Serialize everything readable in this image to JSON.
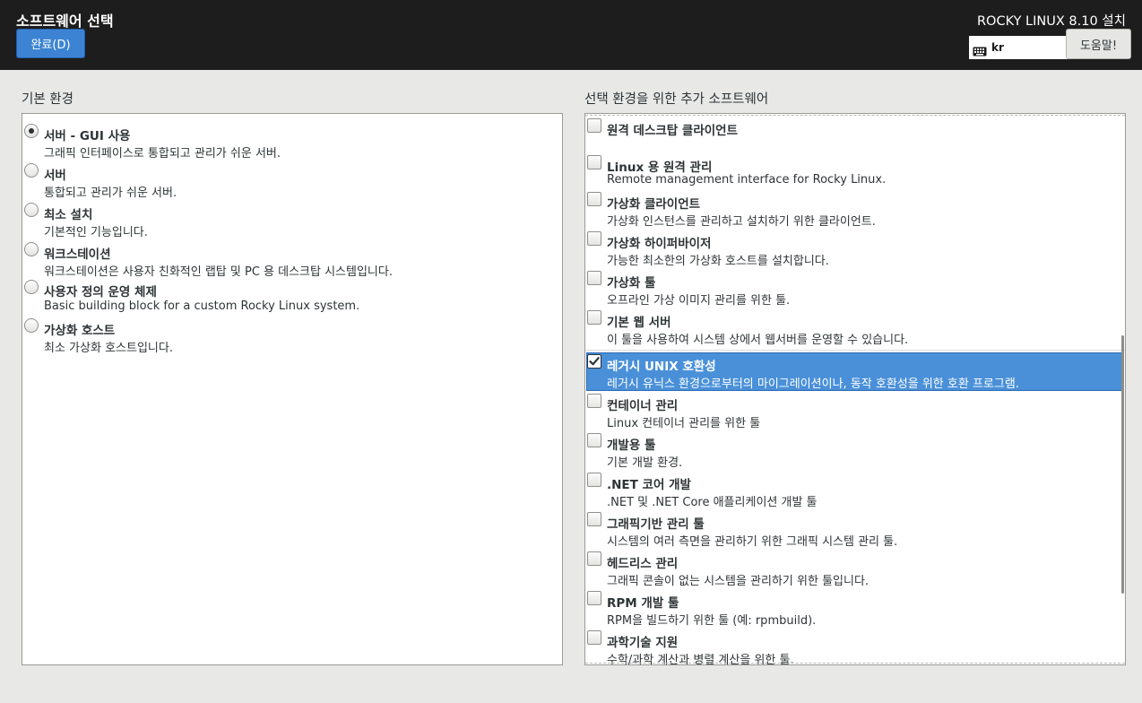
{
  "header": {
    "title": "소프트웨어 선택",
    "done_label": "완료(D)",
    "distro": "ROCKY LINUX 8.10 설치",
    "keyboard_layout": "kr",
    "help_label": "도움말!"
  },
  "base_env": {
    "label": "기본 환경",
    "items": [
      {
        "name": "서버 - GUI 사용",
        "desc": "그래픽 인터페이스로 통합되고 관리가 쉬운 서버.",
        "selected": true
      },
      {
        "name": "서버",
        "desc": "통합되고 관리가 쉬운 서버.",
        "selected": false
      },
      {
        "name": "최소 설치",
        "desc": "기본적인 기능입니다.",
        "selected": false
      },
      {
        "name": "워크스테이션",
        "desc": "워크스테이션은 사용자 친화적인 랩탑 및 PC 용 데스크탑 시스템입니다.",
        "selected": false
      },
      {
        "name": "사용자 정의 운영 체제",
        "desc": "Basic building block for a custom Rocky Linux system.",
        "selected": false
      },
      {
        "name": "가상화 호스트",
        "desc": "최소 가상화 호스트입니다.",
        "selected": false
      }
    ]
  },
  "addons": {
    "label": "선택 환경을 위한 추가 소프트웨어",
    "items": [
      {
        "name": "원격 데스크탑 클라이언트",
        "desc": "",
        "checked": false
      },
      {
        "name": "Linux 용 원격 관리",
        "desc": "Remote management interface for Rocky Linux.",
        "checked": false
      },
      {
        "name": "가상화 클라이언트",
        "desc": "가상화 인스턴스를 관리하고 설치하기 위한 클라이언트.",
        "checked": false
      },
      {
        "name": "가상화 하이퍼바이저",
        "desc": "가능한 최소한의 가상화 호스트를 설치합니다.",
        "checked": false
      },
      {
        "name": "가상화 툴",
        "desc": "오프라인 가상 이미지 관리를 위한 툴.",
        "checked": false
      },
      {
        "name": "기본 웹 서버",
        "desc": "이 툴을 사용하여 시스템 상에서 웹서버를 운영할 수 있습니다.",
        "checked": false
      },
      {
        "name": "레거시 UNIX 호환성",
        "desc": "레거시 유닉스 환경으로부터의 마이그레이션이나, 동작 호환성을 위한 호환 프로그램.",
        "checked": true
      },
      {
        "name": "컨테이너 관리",
        "desc": "Linux 컨테이너 관리를 위한 툴",
        "checked": false
      },
      {
        "name": "개발용 툴",
        "desc": "기본 개발 환경.",
        "checked": false
      },
      {
        "name": ".NET 코어 개발",
        "desc": ".NET 및 .NET Core 애플리케이션 개발 툴",
        "checked": false
      },
      {
        "name": "그래픽기반 관리 툴",
        "desc": "시스템의 여러 측면을 관리하기 위한 그래픽 시스템 관리 툴.",
        "checked": false
      },
      {
        "name": "헤드리스 관리",
        "desc": "그래픽 콘솔이 없는 시스템을 관리하기 위한 툴입니다.",
        "checked": false
      },
      {
        "name": "RPM 개발 툴",
        "desc": "RPM을 빌드하기 위한 툴 (예: rpmbuild).",
        "checked": false
      },
      {
        "name": "과학기술 지원",
        "desc": "수학/과학 계산과 병렬 계산을 위한 툴.",
        "checked": false
      }
    ]
  },
  "colors": {
    "header_bg": "#1d1d1d",
    "accent": "#4a90d9",
    "done_button": "#3c84d3"
  }
}
